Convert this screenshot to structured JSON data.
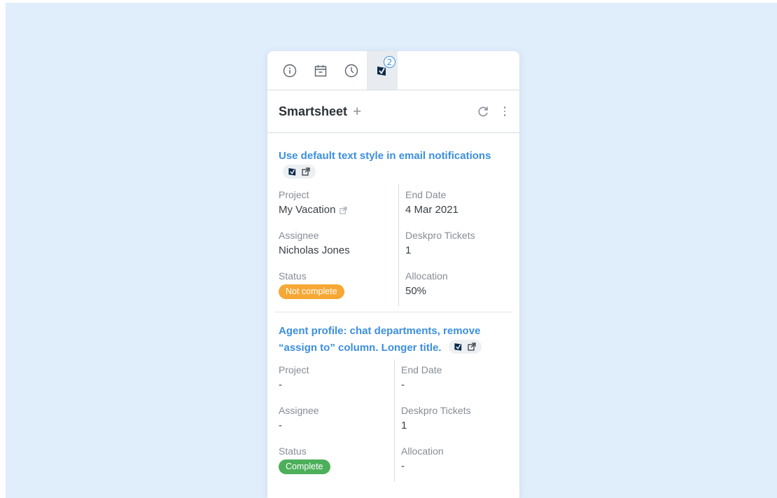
{
  "tabs": [
    {
      "icon": "info-icon"
    },
    {
      "icon": "calendar-icon"
    },
    {
      "icon": "clock-icon"
    },
    {
      "icon": "smartsheet-icon",
      "badge": "2",
      "active": true
    }
  ],
  "header": {
    "title": "Smartsheet",
    "add_label": "+"
  },
  "labels": {
    "project": "Project",
    "end_date": "End Date",
    "assignee": "Assignee",
    "tickets": "Deskpro Tickets",
    "status": "Status",
    "allocation": "Allocation"
  },
  "items": [
    {
      "title": "Use default text style in email notifications",
      "project": "My Vacation",
      "end_date": "4 Mar 2021",
      "assignee": "Nicholas Jones",
      "tickets": "1",
      "status": "Not complete",
      "status_color": "#f7a834",
      "allocation": "50%"
    },
    {
      "title": "Agent profile: chat departments, remove “assign to” column. Longer title.",
      "project": "-",
      "end_date": "-",
      "assignee": "-",
      "tickets": "1",
      "status": "Complete",
      "status_color": "#4caf5a",
      "allocation": "-"
    }
  ],
  "colors": {
    "accent": "#3b8fe0",
    "background": "#e0edfb",
    "brand": "#0b2a4a"
  }
}
